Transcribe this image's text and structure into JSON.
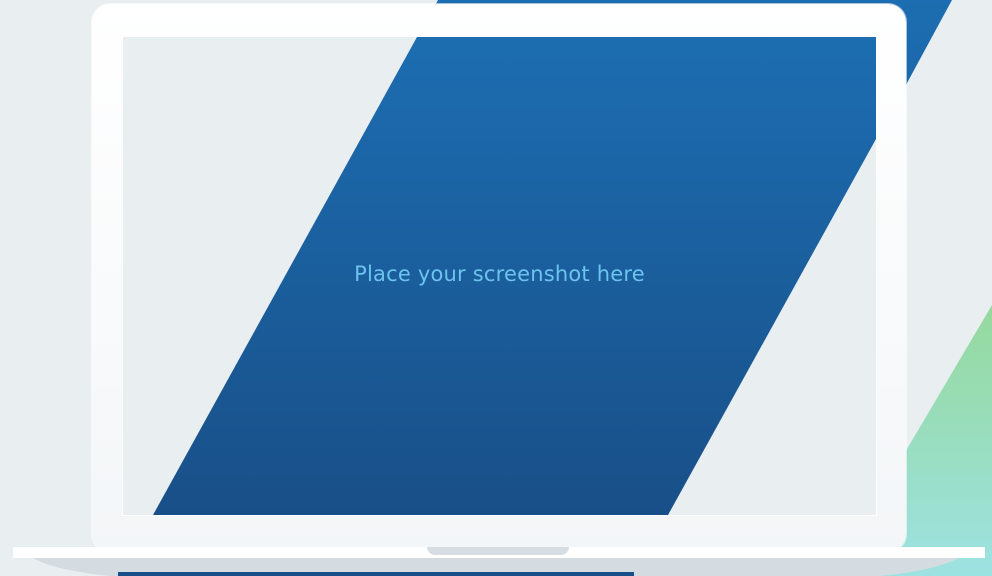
{
  "screen": {
    "placeholder_text": "Place your screenshot here"
  },
  "colors": {
    "background": "#e9eef1",
    "stripe_top": "#1c6db1",
    "stripe_bottom": "#194f88",
    "placeholder_text": "#6cc3ee",
    "accent_green": "#95d99d",
    "accent_teal": "#9de2e2",
    "laptop_frame": "#ffffff"
  }
}
